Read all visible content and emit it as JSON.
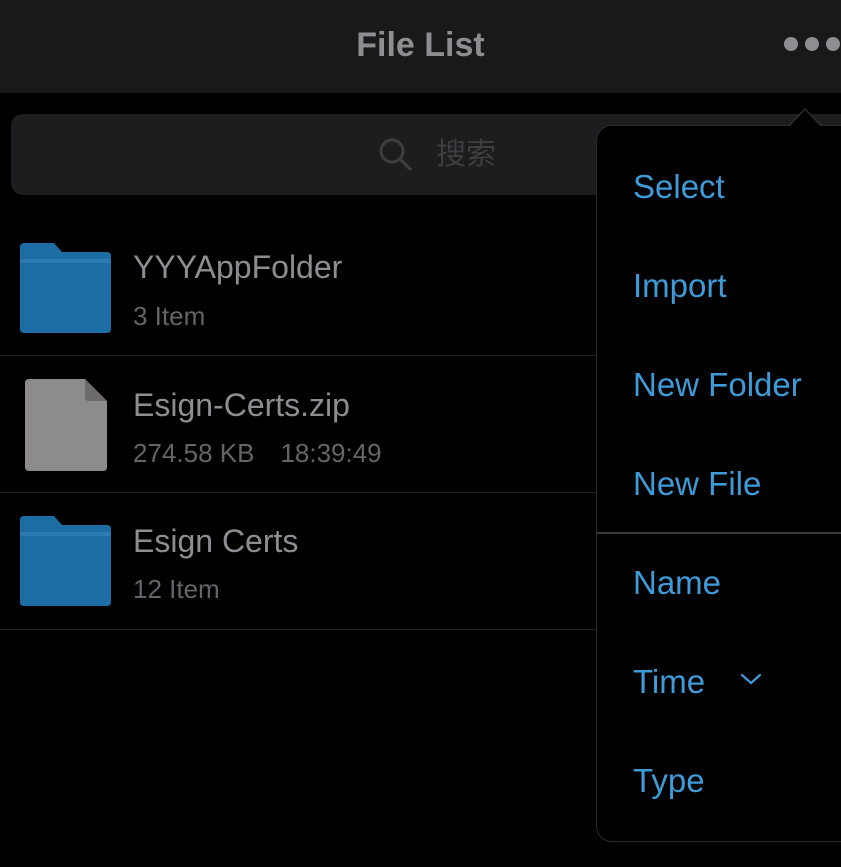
{
  "navbar": {
    "title": "File List",
    "more_icon": "more-horizontal-icon"
  },
  "search": {
    "placeholder": "搜索",
    "icon": "search-icon"
  },
  "files": [
    {
      "name": "YYYAppFolder",
      "meta": [
        "3 Item"
      ],
      "icon": "folder-icon"
    },
    {
      "name": "Esign-Certs.zip",
      "meta": [
        "274.58 KB",
        "18:39:49"
      ],
      "icon": "zip-file-icon"
    },
    {
      "name": "Esign Certs",
      "meta": [
        "12 Item"
      ],
      "icon": "folder-icon"
    }
  ],
  "menu": {
    "actions": [
      {
        "label": "Select"
      },
      {
        "label": "Import"
      },
      {
        "label": "New Folder"
      },
      {
        "label": "New File"
      }
    ],
    "sort": [
      {
        "label": "Name"
      },
      {
        "label": "Time",
        "selected": true,
        "indicator": "chevron-down-icon"
      },
      {
        "label": "Type"
      }
    ]
  },
  "colors": {
    "navbar_bg": "#1a1819",
    "title_text": "#8e8d92",
    "accent": "#3e9bd8",
    "folder": "#1b6da4",
    "file": "#8d8b8c",
    "background": "#000000"
  }
}
